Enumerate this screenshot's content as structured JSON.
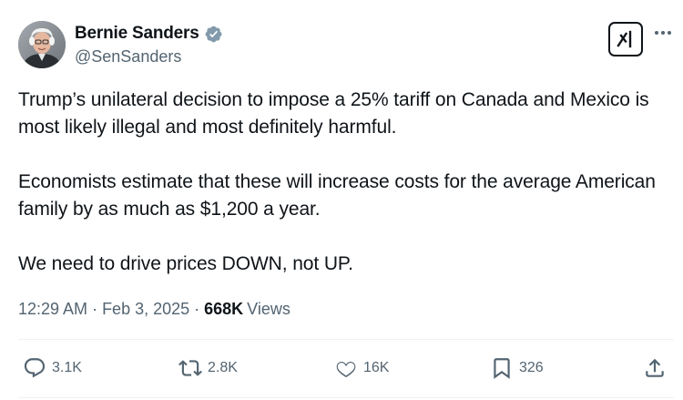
{
  "author": {
    "display_name": "Bernie Sanders",
    "handle": "@SenSanders",
    "verified": true,
    "verified_color": "#829aab"
  },
  "header_icons": {
    "grok": "grok-icon",
    "more": "more-icon"
  },
  "tweet": {
    "paragraphs": [
      "Trump’s unilateral decision to impose a 25% tariff on Canada and Mexico is most likely illegal and most definitely harmful.",
      "Economists estimate that these will increase costs for the average American family by as much as $1,200 a year.",
      "We need to drive prices DOWN, not UP."
    ]
  },
  "meta": {
    "time": "12:29 AM",
    "separator": "·",
    "date": "Feb 3, 2025",
    "views_count": "668K",
    "views_label": "Views"
  },
  "actions": {
    "replies": "3.1K",
    "reposts": "2.8K",
    "likes": "16K",
    "bookmarks": "326",
    "icons": [
      "reply-icon",
      "repost-icon",
      "like-icon",
      "bookmark-icon",
      "share-icon"
    ]
  },
  "colors": {
    "text_primary": "#0f1419",
    "text_secondary": "#536471",
    "divider": "#eff3f4"
  }
}
